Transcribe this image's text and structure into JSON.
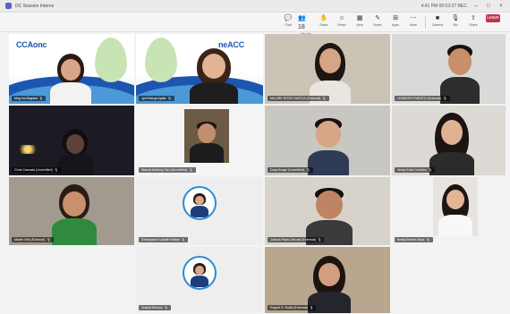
{
  "window": {
    "title": "DC Session Interns",
    "status": "4:41 PM  00:53:27  REC"
  },
  "toolbar": {
    "items": [
      {
        "label": "Chat",
        "icon": "chat-icon",
        "glyph": "💬"
      },
      {
        "label": "People",
        "icon": "people-icon",
        "glyph": "👥",
        "count": "18"
      },
      {
        "label": "Raise",
        "icon": "raise-hand-icon",
        "glyph": "✋"
      },
      {
        "label": "React",
        "icon": "react-icon",
        "glyph": "☺"
      },
      {
        "label": "View",
        "icon": "view-icon",
        "glyph": "▦"
      },
      {
        "label": "Notes",
        "icon": "notes-icon",
        "glyph": "✎"
      },
      {
        "label": "Apps",
        "icon": "apps-icon",
        "glyph": "⊞"
      },
      {
        "label": "More",
        "icon": "more-icon",
        "glyph": "⋯"
      },
      {
        "label": "Camera",
        "icon": "camera-icon",
        "glyph": "■"
      },
      {
        "label": "Mic",
        "icon": "mic-icon",
        "glyph": "🎙"
      },
      {
        "label": "Share",
        "icon": "share-icon",
        "glyph": "⇪"
      }
    ],
    "leave_label": "Leave"
  },
  "brand": {
    "logo1": "CCAᴏnᴄ",
    "logo2": "neACC",
    "primary": "#1d56b0",
    "accent": "#5fb7e8"
  },
  "participants": [
    {
      "name": "Meg Ira Magalal",
      "type": "video"
    },
    {
      "name": "Jyel Marga Ayala",
      "type": "video"
    },
    {
      "name": "MA.ARE ROSE GARCIA (External)",
      "type": "video"
    },
    {
      "name": "LEANDRO PARATO (External)",
      "type": "video"
    },
    {
      "name": "Chris Carnada (Unverified)",
      "type": "video"
    },
    {
      "name": "Marcel Anthony Tan (Unverified)",
      "type": "video"
    },
    {
      "name": "Daryl Arago (Unverified)",
      "type": "video"
    },
    {
      "name": "Jessy Kriss Caridton",
      "type": "video"
    },
    {
      "name": "Marife Villa (External)",
      "type": "video"
    },
    {
      "name": "Decelyanne Ucadth Rafael",
      "type": "avatar"
    },
    {
      "name": "Joshua Paolo Deruse (External)",
      "type": "video"
    },
    {
      "name": "Krista Renee Uaua",
      "type": "video"
    },
    {
      "name": "Scarlet Berrios",
      "type": "avatar"
    },
    {
      "name": "Raymil S. Rullia (External)",
      "type": "video"
    }
  ]
}
